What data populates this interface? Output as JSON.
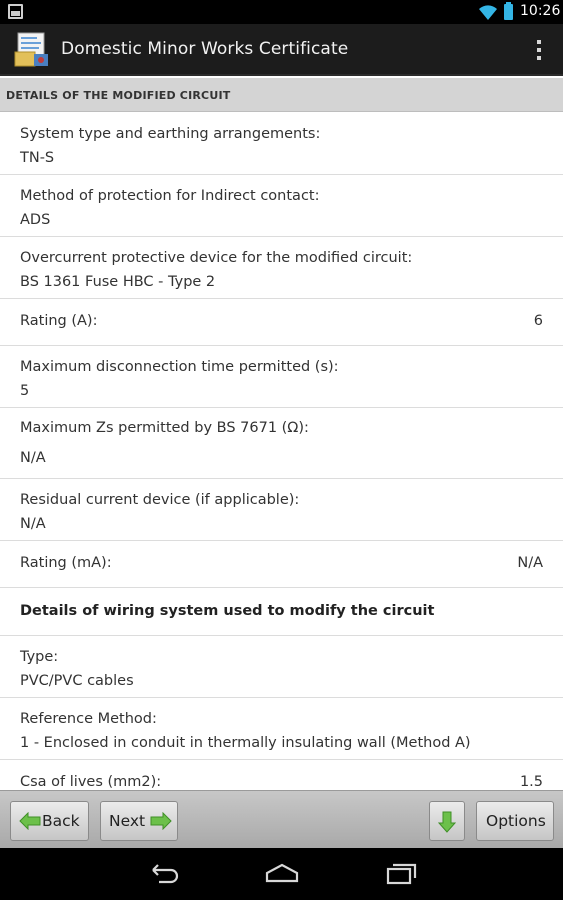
{
  "status_bar": {
    "time": "10:26"
  },
  "app": {
    "title": "Domestic Minor Works Certificate"
  },
  "section": {
    "title": "DETAILS OF THE MODIFIED CIRCUIT"
  },
  "rows": [
    {
      "label": "System type and earthing arrangements:",
      "value": "TN-S"
    },
    {
      "label": "Method of protection for Indirect contact:",
      "value": "ADS"
    },
    {
      "label": "Overcurrent protective device for the modified circuit:",
      "value": "BS 1361 Fuse HBC - Type 2"
    },
    {
      "label": "Rating (A):",
      "value": "6"
    },
    {
      "label": "Maximum disconnection time permitted (s):",
      "value": "5"
    },
    {
      "label": "Maximum Zs permitted by BS 7671 (Ω):",
      "value": "N/A"
    },
    {
      "label": "Residual current device (if applicable):",
      "value": "N/A"
    },
    {
      "label": "Rating (mA):",
      "value": "N/A"
    },
    {
      "label": "Details of wiring system used to modify the circuit"
    },
    {
      "label": "Type:",
      "value": "PVC/PVC cables"
    },
    {
      "label": "Reference Method:",
      "value": "1 - Enclosed in conduit in thermally insulating wall (Method A)"
    },
    {
      "label": "Csa of lives (mm2):",
      "value": "1.5"
    }
  ],
  "toolbar": {
    "back_label": "Back",
    "next_label": "Next",
    "options_label": "Options"
  },
  "colors": {
    "arrow_green": "#6cc04a",
    "status_blue": "#34b5e5"
  },
  "icons": [
    "notification-icon",
    "wifi-icon",
    "battery-icon",
    "app-icon",
    "overflow-menu-icon",
    "back-arrow-icon",
    "next-arrow-icon",
    "download-arrow-icon",
    "nav-back-icon",
    "nav-home-icon",
    "nav-recent-icon"
  ]
}
